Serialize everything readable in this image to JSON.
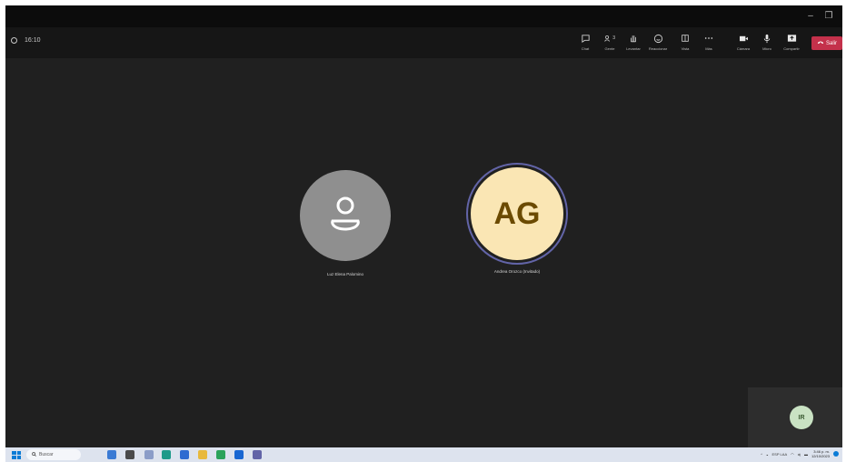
{
  "window": {
    "minimize_label": "–",
    "restore_label": "❐"
  },
  "meeting": {
    "timer": "16:10",
    "toolbar": [
      {
        "name": "chat",
        "label": "Chat",
        "icon": "chat-icon"
      },
      {
        "name": "people",
        "label": "Gente",
        "icon": "people-icon",
        "badge": "3"
      },
      {
        "name": "raise-hand",
        "label": "Levantar",
        "icon": "hand-icon"
      },
      {
        "name": "react",
        "label": "Reaccionar",
        "icon": "smile-icon"
      },
      {
        "name": "view",
        "label": "Vista",
        "icon": "view-icon"
      },
      {
        "name": "more",
        "label": "Más",
        "icon": "more-icon"
      },
      {
        "name": "camera",
        "label": "Cámara",
        "icon": "camera-icon"
      },
      {
        "name": "mic",
        "label": "Micro",
        "icon": "mic-icon"
      },
      {
        "name": "share",
        "label": "Compartir",
        "icon": "share-icon"
      }
    ],
    "leave_label": "Salir",
    "leave_color": "#c4314b"
  },
  "participants": [
    {
      "name": "Luz Elena Palomino",
      "initials": "",
      "avatar_color": "#8f8f8f"
    },
    {
      "name": "Andrea Orozco (Invitado)",
      "initials": "AG",
      "avatar_color": "#fae6b4",
      "speaking": true
    }
  ],
  "self_view": {
    "initials": "IR",
    "avatar_color": "#c9e2c3"
  },
  "taskbar": {
    "search_placeholder": "Buscar",
    "tray": {
      "language": "ESP LAA",
      "time": "3:46 p. m.",
      "date": "12/10/2023"
    }
  }
}
